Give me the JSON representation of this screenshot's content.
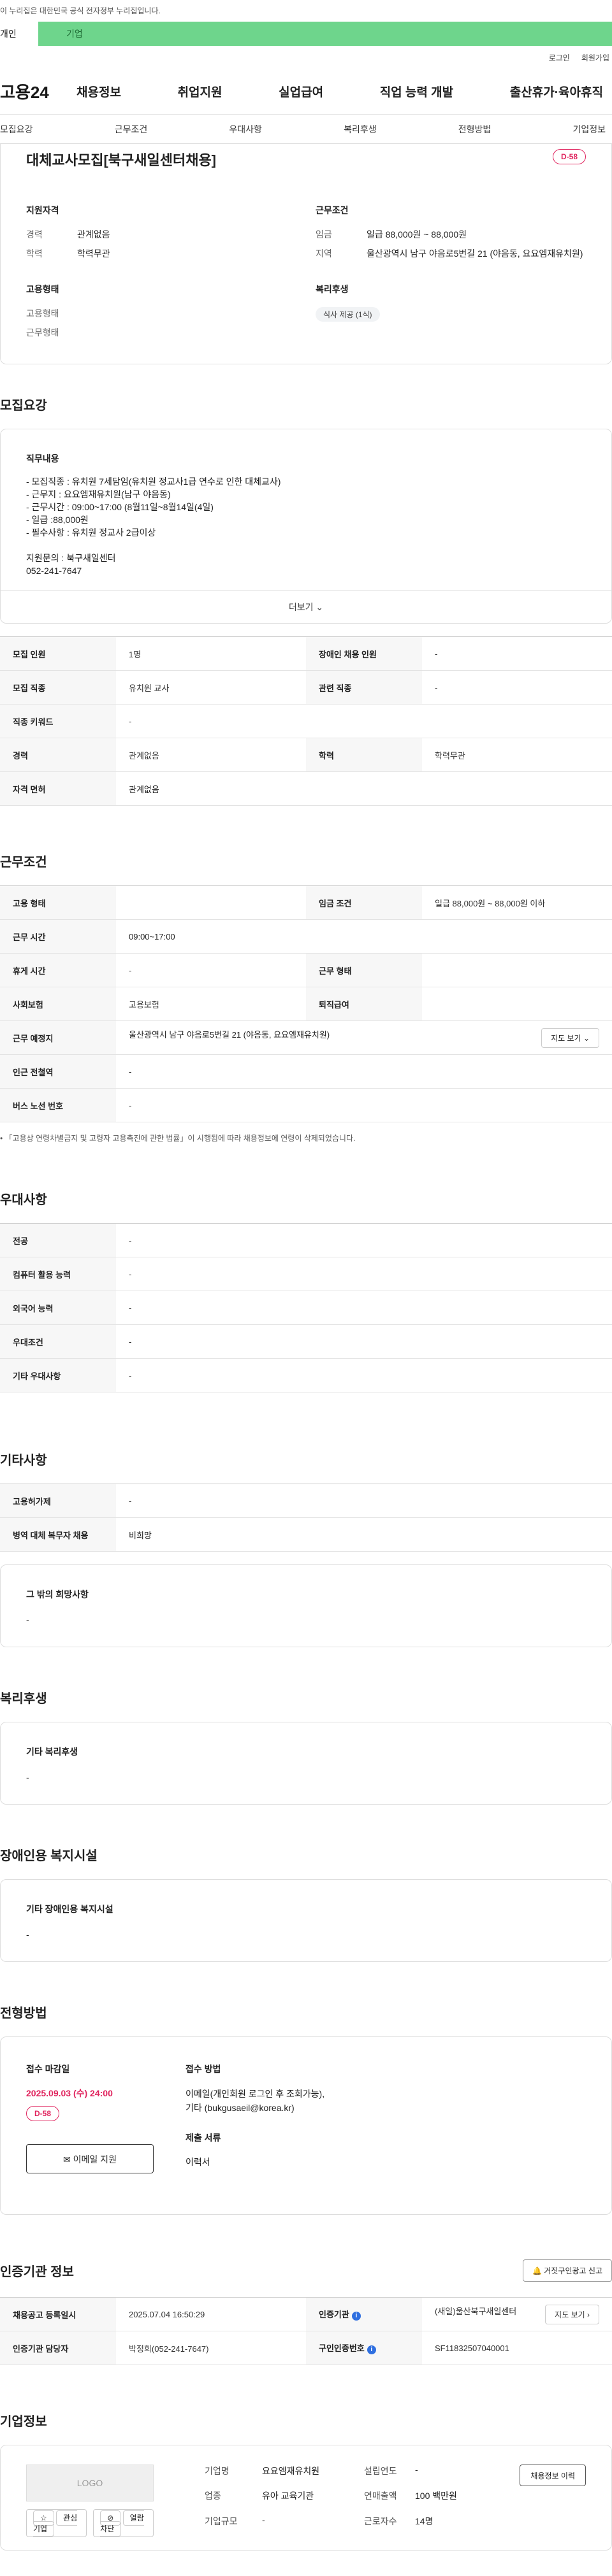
{
  "notice": "이 누리집은 대한민국 공식 전자정부 누리집입니다.",
  "top_tabs": {
    "left": "개인",
    "right": "기업"
  },
  "util": {
    "login": "로그인",
    "join": "회원가입"
  },
  "gnb": {
    "logo": "고용24",
    "menu": [
      "채용정보",
      "취업지원",
      "실업급여",
      "직업 능력 개발",
      "출산휴가·육아휴직"
    ]
  },
  "subtabs": [
    "모집요강",
    "근무조건",
    "우대사항",
    "복리후생",
    "전형방법",
    "기업정보"
  ],
  "summary": {
    "title": "대체교사모집[북구새일센터채용]",
    "dday": "D-58",
    "qual_title": "지원자격",
    "career_k": "경력",
    "career_v": "관계없음",
    "edu_k": "학력",
    "edu_v": "학력무관",
    "cond_title": "근무조건",
    "wage_k": "임금",
    "wage_v": "일급 88,000원 ~ 88,000원",
    "area_k": "지역",
    "area_v": "울산광역시 남구 야음로5번길 21 (야음동, 요요엠재유치원)",
    "emp_title": "고용형태",
    "emp_k": "고용형태",
    "emp_v": "",
    "work_k": "근무형태",
    "work_v": "",
    "welfare_title": "복리후생",
    "welfare_chip": "식사 제공 (1식)"
  },
  "recruit": {
    "section_title": "모집요강",
    "job_title": "직무내용",
    "lines": [
      "- 모집직종 : 유치원 7세담임(유치원 정교사1급 연수로 인한 대체교사)",
      "- 근무지 : 요요엠재유치원(남구 야음동)",
      "- 근무시간 : 09:00~17:00 (8월11일~8월14일(4일)",
      "- 일급 :88,000원",
      "- 필수사항 : 유치원 정교사 2급이상",
      "",
      "지원문의 : 북구새일센터",
      "052-241-7647"
    ],
    "more": "더보기",
    "table": {
      "headcount_k": "모집 인원",
      "headcount_v": "1명",
      "disabled_k": "장애인 채용 인원",
      "disabled_v": "-",
      "job_k": "모집 직종",
      "job_v": "유치원 교사",
      "related_k": "관련 직종",
      "related_v": "-",
      "keyword_k": "직종 키워드",
      "keyword_v": "-",
      "career_k": "경력",
      "career_v": "관계없음",
      "edu_k": "학력",
      "edu_v": "학력무관",
      "license_k": "자격 면허",
      "license_v": "관계없음"
    }
  },
  "conditions": {
    "section_title": "근무조건",
    "emp_k": "고용 형태",
    "emp_v": "",
    "wage_k": "임금 조건",
    "wage_v": "일급 88,000원 ~ 88,000원 이하",
    "hours_k": "근무 시간",
    "hours_v": "09:00~17:00",
    "rest_k": "휴게 시간",
    "rest_v": "-",
    "type_k": "근무 형태",
    "type_v": "",
    "ins_k": "사회보험",
    "ins_v": "고용보험",
    "sev_k": "퇴직급여",
    "sev_v": "",
    "place_k": "근무 예정지",
    "place_v": "울산광역시 남구 야음로5번길 21 (야음동, 요요엠재유치원)",
    "map_btn": "지도 보기",
    "subway_k": "인근 전철역",
    "subway_v": "-",
    "bus_k": "버스 노선 번호",
    "bus_v": "-",
    "footnote": "「고용상 연령차별금지 및 고령자 고용촉진에 관한 법률」이 시행됨에 따라 채용정보에 연령이 삭제되었습니다."
  },
  "preference": {
    "section_title": "우대사항",
    "rows": [
      {
        "k": "전공",
        "v": "-"
      },
      {
        "k": "컴퓨터 활용 능력",
        "v": "-"
      },
      {
        "k": "외국어 능력",
        "v": "-"
      },
      {
        "k": "우대조건",
        "v": "-"
      },
      {
        "k": "기타 우대사항",
        "v": "-"
      }
    ]
  },
  "etc": {
    "section_title": "기타사항",
    "rows": [
      {
        "k": "고용허가제",
        "v": "-"
      },
      {
        "k": "병역 대체 복무자 채용",
        "v": "비희망"
      }
    ],
    "other_title": "그 밖의 희망사항",
    "other_v": "-"
  },
  "welfare": {
    "section_title": "복리후생",
    "item_title": "기타 복리후생",
    "item_v": "-"
  },
  "facility": {
    "section_title": "장애인용 복지시설",
    "item_title": "기타 장애인용 복지시설",
    "item_v": "-"
  },
  "apply": {
    "section_title": "전형방법",
    "deadline_title": "접수 마감일",
    "deadline": "2025.09.03 (수) 24:00",
    "dday": "D-58",
    "email_btn": "이메일 지원",
    "method_title": "접수 방법",
    "method_lines": [
      "이메일(개인회원 로그인 후 조회가능),",
      "기타 (bukgusaeil@korea.kr)"
    ],
    "docs_title": "제출 서류",
    "docs_v": "이력서"
  },
  "cert": {
    "section_title": "인증기관 정보",
    "report_btn": "거짓구인광고 신고",
    "regdate_k": "채용공고 등록일시",
    "regdate_v": "2025.07.04 16:50:29",
    "agency_k": "인증기관",
    "agency_v": "(새일)울산북구새일센터",
    "detail_btn": "지도 보기",
    "manager_k": "인증기관 담당자",
    "manager_v": "박정희(052-241-7647)",
    "reqno_k": "구인인증번호",
    "reqno_v": "SF11832507040001"
  },
  "company": {
    "section_title": "기업정보",
    "logo": "LOGO",
    "fav_btn": "관심기업",
    "block_btn": "열람차단",
    "name_k": "기업명",
    "name_v": "요요엠재유치원",
    "founded_k": "설립연도",
    "founded_v": "-",
    "industry_k": "업종",
    "industry_v": "유아 교육기관",
    "sales_k": "연매출액",
    "sales_v": "100 백만원",
    "size_k": "기업규모",
    "size_v": "-",
    "staff_k": "근로자수",
    "staff_v": "14명",
    "history_btn": "채용정보 이력"
  }
}
